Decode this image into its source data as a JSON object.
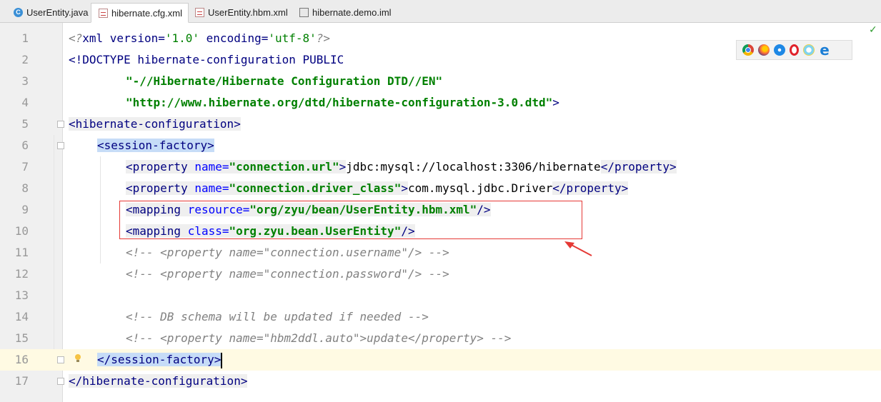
{
  "tabs": [
    {
      "label": "UserEntity.java",
      "icon": "java-class-icon",
      "active": false
    },
    {
      "label": "hibernate.cfg.xml",
      "icon": "xml-file-icon",
      "active": true
    },
    {
      "label": "UserEntity.hbm.xml",
      "icon": "xml-file-icon",
      "active": false
    },
    {
      "label": "hibernate.demo.iml",
      "icon": "iml-file-icon",
      "active": false
    }
  ],
  "close_glyph": "×",
  "line_numbers": [
    "1",
    "2",
    "3",
    "4",
    "5",
    "6",
    "7",
    "8",
    "9",
    "10",
    "11",
    "12",
    "13",
    "14",
    "15",
    "16",
    "17"
  ],
  "code": {
    "l1": {
      "open": "<?",
      "decl": "xml version=",
      "ver": "'1.0'",
      "enc": " encoding=",
      "encv": "'utf-8'",
      "close": "?>"
    },
    "l2": {
      "doctype": "<!DOCTYPE hibernate-configuration PUBLIC"
    },
    "l3": {
      "dtd": "\"-//Hibernate/Hibernate Configuration DTD//EN\""
    },
    "l4": {
      "url": "\"http://www.hibernate.org/dtd/hibernate-configuration-3.0.dtd\"",
      "close": ">"
    },
    "l5": {
      "tag": "<hibernate-configuration>"
    },
    "l6": {
      "tag": "<session-factory>"
    },
    "l7": {
      "open": "<property",
      "attr": " name=",
      "val": "\"connection.url\"",
      "gt": ">",
      "text": "jdbc:mysql://localhost:3306/hibernate",
      "end": "</property>"
    },
    "l8": {
      "open": "<property",
      "attr": " name=",
      "val": "\"connection.driver_class\"",
      "gt": ">",
      "text": "com.mysql.jdbc.Driver",
      "end": "</property>"
    },
    "l9": {
      "open": "<mapping",
      "attr": " resource=",
      "val": "\"org/zyu/bean/UserEntity.hbm.xml\"",
      "end": "/>"
    },
    "l10": {
      "open": "<mapping",
      "attr": " class=",
      "val": "\"org.zyu.bean.UserEntity\"",
      "end": "/>"
    },
    "l11": {
      "comment": "<!-- <property name=\"connection.username\"/> -->"
    },
    "l12": {
      "comment": "<!-- <property name=\"connection.password\"/> -->"
    },
    "l13": {
      "comment": ""
    },
    "l14": {
      "comment": "<!-- DB schema will be updated if needed -->"
    },
    "l15": {
      "comment": "<!-- <property name=\"hbm2ddl.auto\">update</property> -->"
    },
    "l16": {
      "tag": "</session-factory>"
    },
    "l17": {
      "tag": "</hibernate-configuration>"
    }
  },
  "browser_icons": [
    "chrome-icon",
    "firefox-icon",
    "safari-icon",
    "opera-icon",
    "ie-old-icon",
    "edge-icon"
  ],
  "edge_glyph": "e",
  "status_check": "✓",
  "colors": {
    "tag": "#000080",
    "attr": "#0000ff",
    "value": "#008000",
    "comment": "#808080",
    "selection": "#c6dcf7",
    "current_line": "#fffae3",
    "annotation": "#e53935"
  }
}
